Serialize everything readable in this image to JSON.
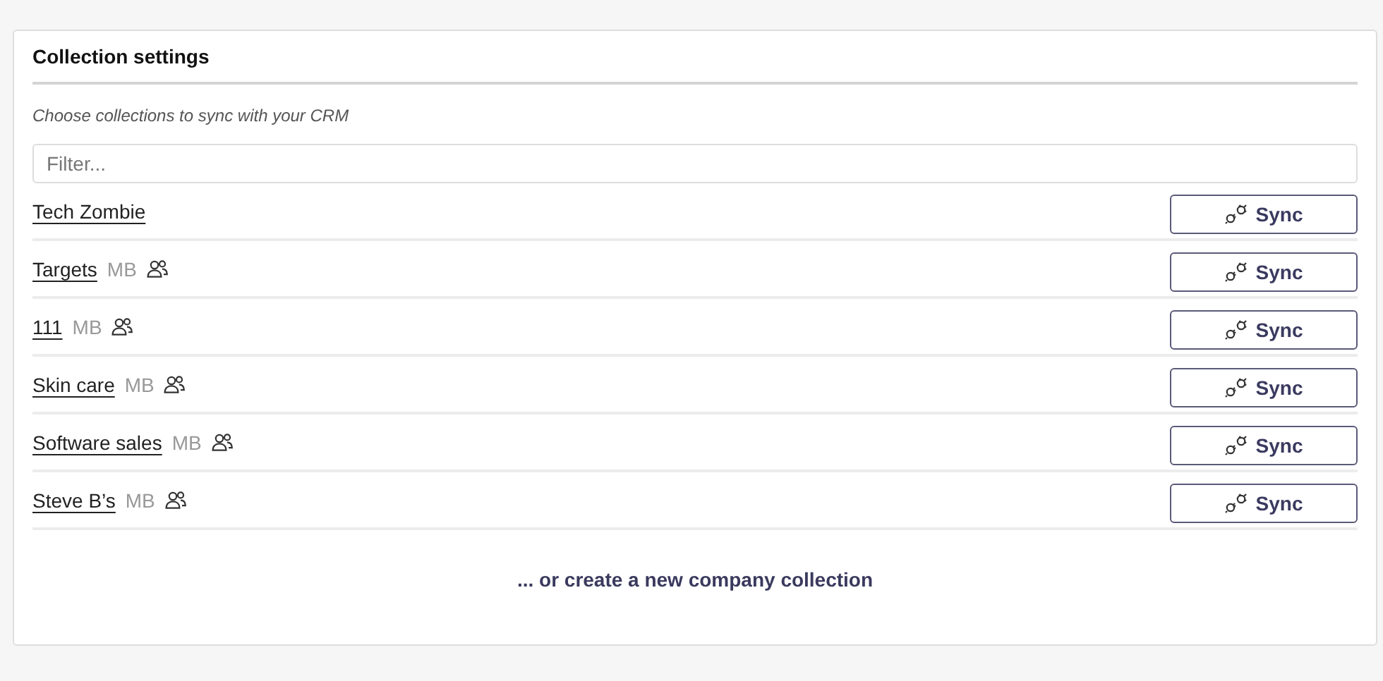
{
  "title": "Collection settings",
  "description": "Choose collections to sync with your CRM",
  "filter": {
    "placeholder": "Filter..."
  },
  "collections": [
    {
      "name": "Tech Zombie",
      "shared": false,
      "button": "Sync"
    },
    {
      "name": "Targets",
      "owner": "MB",
      "shared": true,
      "button": "Sync"
    },
    {
      "name": "111",
      "owner": "MB",
      "shared": true,
      "button": "Sync"
    },
    {
      "name": "Skin care",
      "owner": "MB",
      "shared": true,
      "button": "Sync"
    },
    {
      "name": "Software sales",
      "owner": "MB",
      "shared": true,
      "button": "Sync"
    },
    {
      "name": "Steve B’s",
      "owner": "MB",
      "shared": true,
      "button": "Sync"
    }
  ],
  "create_link": "... or create a new company collection"
}
